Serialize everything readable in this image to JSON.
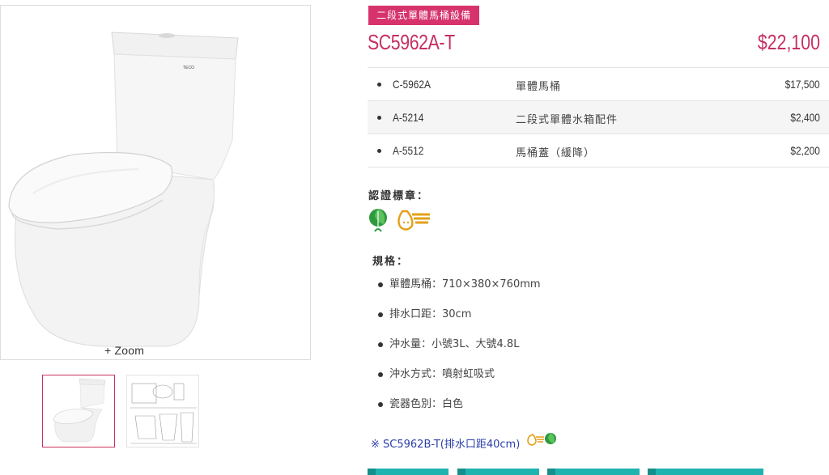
{
  "gallery": {
    "zoom_label": "+ Zoom",
    "product_brand_mark": "TECO",
    "thumbnails": [
      "product-photo",
      "technical-drawing"
    ],
    "selected_thumbnail": 0
  },
  "product": {
    "category_badge": "二段式單體馬桶設備",
    "code": "SC5962A-T",
    "price": "$22,100"
  },
  "parts": [
    {
      "code": "C-5962A",
      "name": "單體馬桶",
      "price": "$17,500"
    },
    {
      "code": "A-5214",
      "name": "二段式單體水箱配件",
      "price": "$2,400"
    },
    {
      "code": "A-5512",
      "name": "馬桶蓋（緩降）",
      "price": "$2,200"
    }
  ],
  "certification": {
    "title": "認證標章：",
    "icons": [
      "green-mark-icon",
      "water-saving-mark-icon"
    ]
  },
  "specs": {
    "title": "規格：",
    "items": [
      "單體馬桶：710×380×760mm",
      "排水口距：30cm",
      "沖水量：小號3L、大號4.8L",
      "沖水方式：噴射虹吸式",
      "瓷器色別：白色"
    ]
  },
  "note": {
    "text": "※ SC5962B-T(排水口距40cm)"
  },
  "colors": {
    "accent": "#c62f63",
    "badge": "#d6336c",
    "link": "#2a3faa",
    "button": "#1fb3b0"
  }
}
